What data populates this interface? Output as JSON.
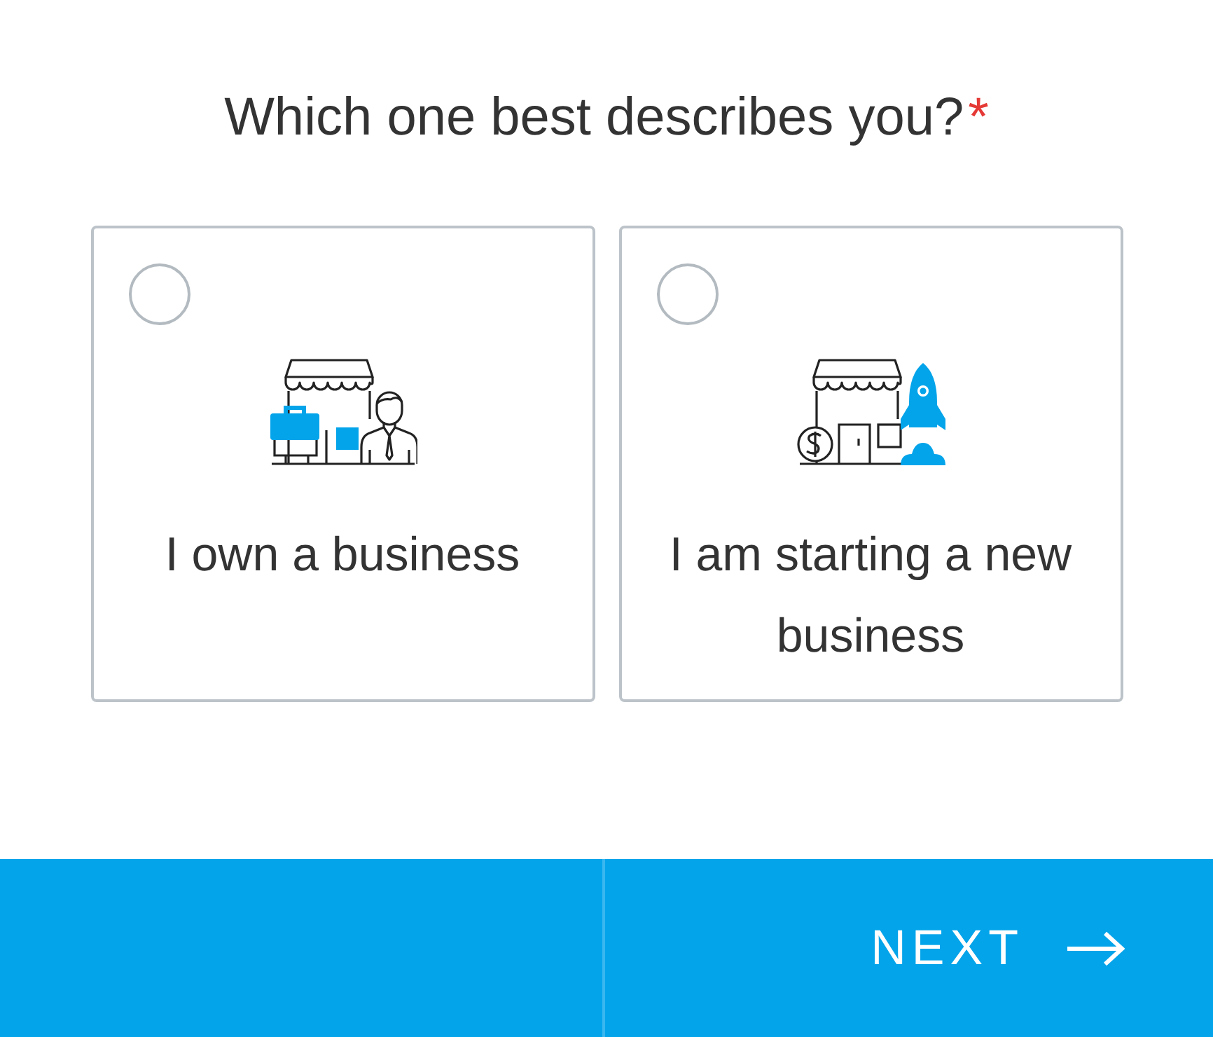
{
  "question": {
    "text": "Which one best describes you?",
    "required_mark": "*"
  },
  "options": [
    {
      "kind": "owner",
      "label": "I own a business",
      "selected": false
    },
    {
      "kind": "startup",
      "label": "I am starting a new business",
      "selected": false
    }
  ],
  "footer": {
    "next_button": {
      "label": "NEXT"
    }
  }
}
